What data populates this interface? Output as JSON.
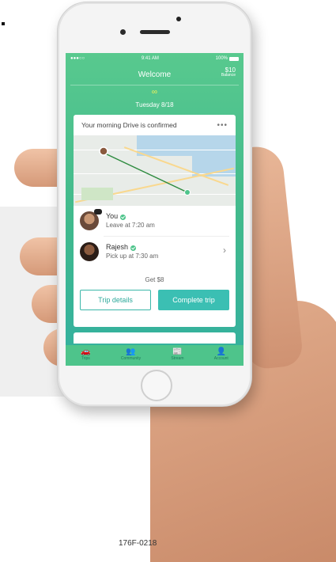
{
  "status": {
    "signal": "●●●○○",
    "time": "9:41 AM",
    "battery": "100%"
  },
  "header": {
    "title": "Welcome",
    "balance_amount": "$10",
    "balance_label": "Balance"
  },
  "date": {
    "icon": "∞",
    "text": "Tuesday 8/18"
  },
  "card": {
    "title": "Your morning Drive is confirmed",
    "menu": "•••",
    "driver": {
      "name": "You",
      "detail": "Leave at 7:20 am"
    },
    "rider": {
      "name": "Rajesh",
      "detail": "Pick up at 7:30 am"
    },
    "earn": "Get $8",
    "buttons": {
      "details": "Trip details",
      "complete": "Complete trip"
    }
  },
  "tabs": [
    {
      "label": "Trips",
      "icon": "car-icon",
      "glyph": "🚗"
    },
    {
      "label": "Community",
      "icon": "people-icon",
      "glyph": "👥"
    },
    {
      "label": "Stream",
      "icon": "newspaper-icon",
      "glyph": "📰"
    },
    {
      "label": "Account",
      "icon": "user-icon",
      "glyph": "👤"
    }
  ],
  "caption": "176F-0218",
  "colors": {
    "brand_green": "#4ec48b",
    "accent_teal": "#3bbfb3",
    "route": "#2e8b3f"
  }
}
